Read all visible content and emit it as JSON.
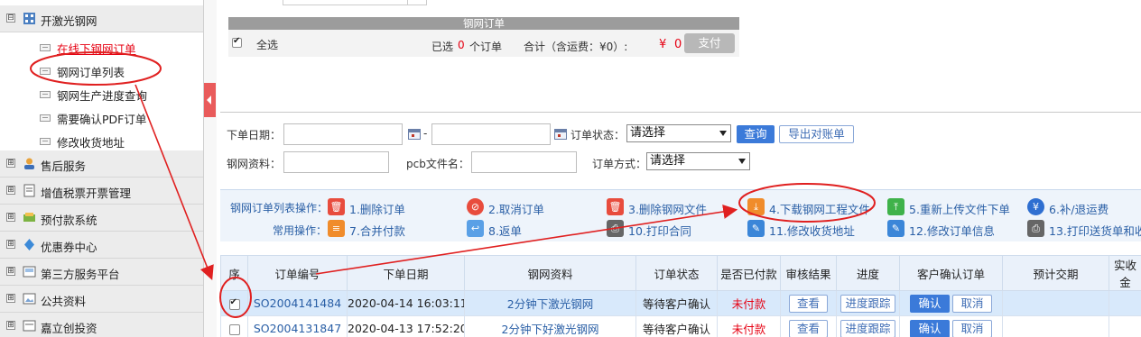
{
  "sidebar": {
    "groups": [
      {
        "label": "开激光钢网",
        "toggle": "⊟",
        "icon": "steel-mesh-icon"
      },
      {
        "label": "售后服务",
        "toggle": "⊞",
        "icon": "after-sales-icon"
      },
      {
        "label": "增值税票开票管理",
        "toggle": "⊞",
        "icon": "invoice-icon"
      },
      {
        "label": "预付款系统",
        "toggle": "⊞",
        "icon": "prepay-icon"
      },
      {
        "label": "优惠券中心",
        "toggle": "⊞",
        "icon": "coupon-icon"
      },
      {
        "label": "第三方服务平台",
        "toggle": "⊞",
        "icon": "third-party-icon"
      },
      {
        "label": "公共资料",
        "toggle": "⊞",
        "icon": "public-docs-icon"
      },
      {
        "label": "嘉立创投资",
        "toggle": "⊞",
        "icon": "investment-icon"
      }
    ],
    "sub_items": [
      {
        "label": "在线下钢网订单"
      },
      {
        "label": "钢网订单列表"
      },
      {
        "label": "钢网生产进度查询"
      },
      {
        "label": "需要确认PDF订单"
      },
      {
        "label": "修改收货地址"
      }
    ]
  },
  "payment": {
    "title": "钢网订单",
    "select_all": "全选",
    "selected_prefix": "已选",
    "selected_count": "0",
    "selected_suffix": "个订单",
    "total_label": "合计（含运费：¥0）:",
    "total_currency": "¥",
    "total_value": "0",
    "pay_button": "支付"
  },
  "search": {
    "order_date_label": "下单日期：",
    "date_sep": "-",
    "order_status_label": "订单状态：",
    "order_status_value": "请选择",
    "query_button": "查询",
    "export_button": "导出对账单",
    "mesh_info_label": "钢网资料：",
    "pcb_file_label": "pcb文件名：",
    "order_method_label": "订单方式：",
    "order_method_value": "请选择"
  },
  "operations": {
    "list_ops_label": "钢网订单列表操作：",
    "common_ops_label": "常用操作：",
    "items": [
      {
        "label": "1.删除订单",
        "icon": "trash-icon",
        "color": "#e84c3d"
      },
      {
        "label": "2.取消订单",
        "icon": "cancel-icon",
        "color": "#e84c3d"
      },
      {
        "label": "3.删除钢网文件",
        "icon": "trash-icon",
        "color": "#e84c3d"
      },
      {
        "label": "4.下载钢网工程文件",
        "icon": "download-icon",
        "color": "#f08c2b"
      },
      {
        "label": "5.重新上传文件下单",
        "icon": "upload-icon",
        "color": "#3fb24a"
      },
      {
        "label": "6.补/退运费",
        "icon": "yen-icon",
        "color": "#2f6fd1"
      },
      {
        "label": "7.合并付款",
        "icon": "merge-pay-icon",
        "color": "#f08c2b"
      },
      {
        "label": "8.返单",
        "icon": "return-icon",
        "color": "#5aa0e6"
      },
      {
        "label": "10.打印合同",
        "icon": "printer-icon",
        "color": "#666666"
      },
      {
        "label": "11.修改收货地址",
        "icon": "edit-icon",
        "color": "#3b86d8"
      },
      {
        "label": "12.修改订单信息",
        "icon": "edit-icon",
        "color": "#3b86d8"
      },
      {
        "label": "13.打印送货单和收",
        "icon": "printer-icon",
        "color": "#666666"
      }
    ]
  },
  "table": {
    "headers": [
      "序",
      "订单编号",
      "下单日期",
      "钢网资料",
      "订单状态",
      "是否已付款",
      "审核结果",
      "进度",
      "客户确认订单",
      "预计交期",
      "实收金"
    ],
    "rows": [
      {
        "order_no": "SO2004141484",
        "date": "2020-04-14 16:03:11",
        "mesh": "2分钟下激光钢网",
        "status": "等待客户确认",
        "paid": "未付款",
        "review": "查看",
        "progress": "进度跟踪",
        "confirm": "确认",
        "cancel": "取消",
        "checked": true
      },
      {
        "order_no": "SO2004131847",
        "date": "2020-04-13 17:52:20",
        "mesh": "2分钟下好激光钢网",
        "status": "等待客户确认",
        "paid": "未付款",
        "review": "查看",
        "progress": "进度跟踪",
        "confirm": "确认",
        "cancel": "取消",
        "checked": false
      }
    ]
  },
  "colors": {
    "accent_red": "#e60012",
    "link_blue": "#2a5fa6",
    "button_blue": "#3b7ad9",
    "annotation_red": "#e02020"
  }
}
